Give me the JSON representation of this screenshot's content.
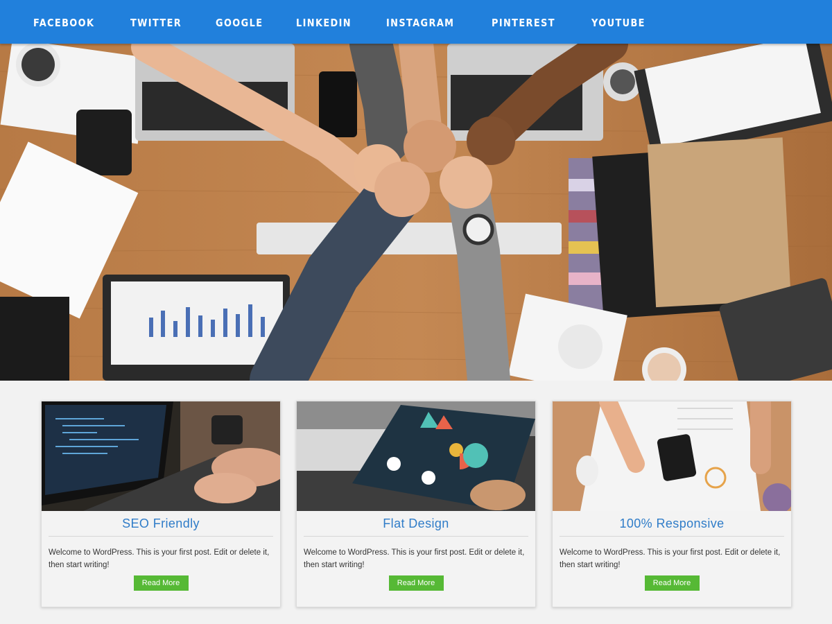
{
  "nav": {
    "items": [
      "FACEBOOK",
      "TWITTER",
      "GOOGLE",
      "LINKEDIN",
      "INSTAGRAM",
      "PINTEREST",
      "YOUTUBE"
    ]
  },
  "colors": {
    "nav_bg": "#2180dc",
    "title": "#2f7cc8",
    "button": "#56b935",
    "page_bg": "#f2f2f2"
  },
  "cards": [
    {
      "title": "SEO Friendly",
      "text": "Welcome to WordPress. This is your first post. Edit or delete it, then start writing!",
      "button": "Read More",
      "image": "laptop-code-photo"
    },
    {
      "title": "Flat Design",
      "text": "Welcome to WordPress. This is your first post. Edit or delete it, then start writing!",
      "button": "Read More",
      "image": "infographic-notebook-photo"
    },
    {
      "title": "100% Responsive",
      "text": "Welcome to WordPress. This is your first post. Edit or delete it, then start writing!",
      "button": "Read More",
      "image": "desk-smartphone-photo"
    }
  ],
  "hero": {
    "image": "team-fist-bump-desk-photo"
  }
}
